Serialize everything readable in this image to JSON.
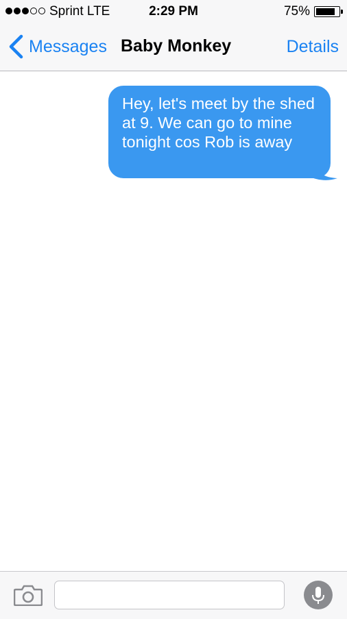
{
  "status_bar": {
    "signal_bars_filled": 3,
    "signal_bars_total": 5,
    "carrier": "Sprint  LTE",
    "time": "2:29 PM",
    "battery_percent": "75%",
    "battery_level": 0.75
  },
  "nav": {
    "back_label": "Messages",
    "title": "Baby Monkey",
    "details_label": "Details"
  },
  "messages": [
    {
      "direction": "outgoing",
      "text": "Hey, let's meet by the shed at 9. We can go to mine tonight cos Rob is away"
    }
  ],
  "input_bar": {
    "icons": [
      "camera-icon",
      "microphone-icon"
    ],
    "message_value": ""
  },
  "colors": {
    "accent": "#1a82f2",
    "outgoing_bubble": "#3a98f0",
    "bar_background": "#f7f7f8",
    "mic_background": "#8a8b8f"
  }
}
